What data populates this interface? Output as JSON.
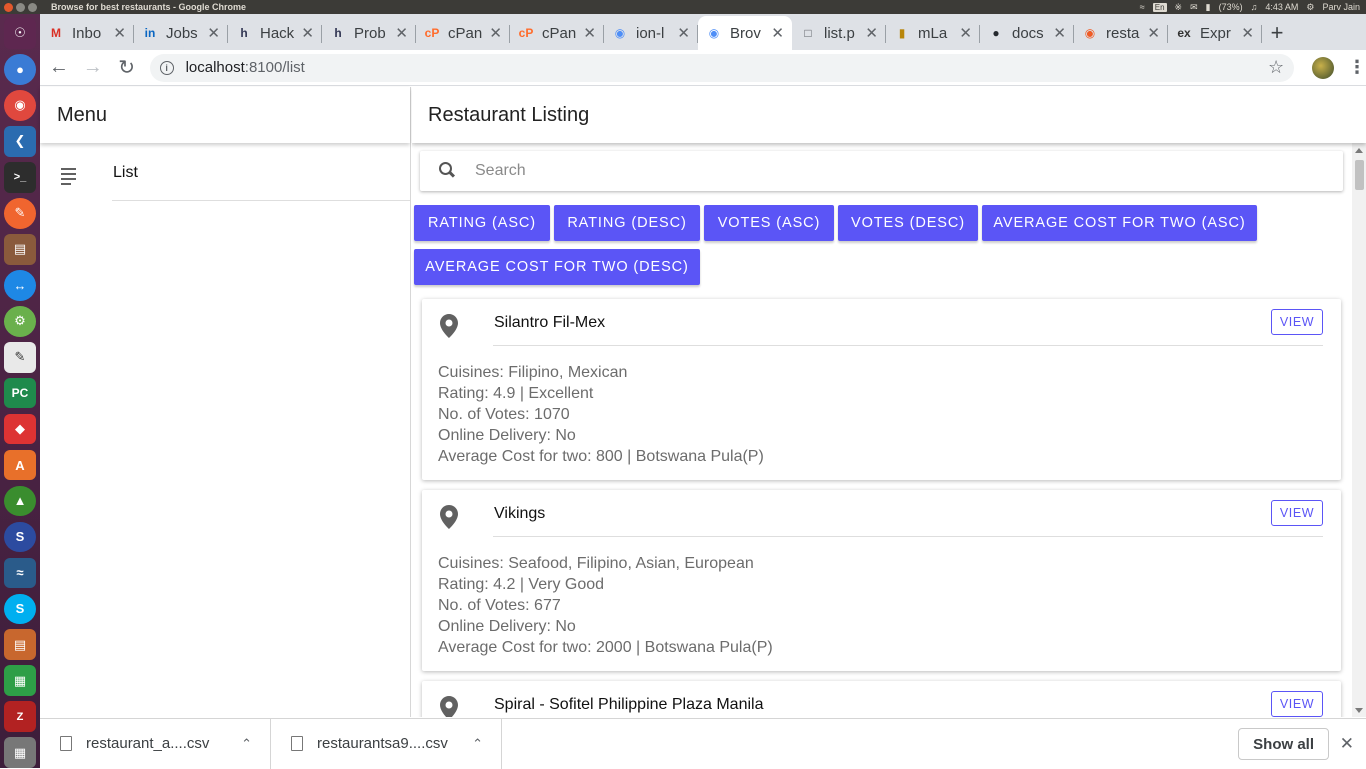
{
  "os": {
    "window_title": "Browse for best restaurants - Google Chrome",
    "tray": {
      "battery": "(73%)",
      "time": "4:43 AM",
      "user": "Parv Jain",
      "lang": "En"
    }
  },
  "browser": {
    "tabs": [
      {
        "label": "Inbo",
        "icon": "gmail-icon",
        "active": false
      },
      {
        "label": "Jobs",
        "icon": "linkedin-icon",
        "active": false
      },
      {
        "label": "Hack",
        "icon": "hackerearth-icon",
        "active": false
      },
      {
        "label": "Prob",
        "icon": "hackerearth-icon",
        "active": false
      },
      {
        "label": "cPan",
        "icon": "cpanel-icon",
        "active": false
      },
      {
        "label": "cPan",
        "icon": "cpanel-icon",
        "active": false
      },
      {
        "label": "ion-l",
        "icon": "ionic-icon",
        "active": false
      },
      {
        "label": "Brov",
        "icon": "ionic-icon",
        "active": true
      },
      {
        "label": "list.p",
        "icon": "file-icon",
        "active": false
      },
      {
        "label": "mLa",
        "icon": "mlab-icon",
        "active": false
      },
      {
        "label": "docs",
        "icon": "github-icon",
        "active": false
      },
      {
        "label": "resta",
        "icon": "postman-icon",
        "active": false
      },
      {
        "label": "Expr",
        "icon": "express-icon",
        "active": false
      }
    ],
    "url_host": "localhost",
    "url_path": ":8100/list"
  },
  "app": {
    "menu_title": "Menu",
    "menu_items": [
      {
        "label": "List"
      }
    ],
    "page_title": "Restaurant Listing",
    "search_placeholder": "Search",
    "sort_buttons": [
      "RATING (ASC)",
      "RATING (DESC)",
      "VOTES (ASC)",
      "VOTES (DESC)",
      "AVERAGE COST FOR TWO (ASC)",
      "AVERAGE COST FOR TWO (DESC)"
    ],
    "view_label": "VIEW",
    "restaurants": [
      {
        "name": "Silantro Fil-Mex",
        "cuisines": "Cuisines: Filipino, Mexican",
        "rating": "Rating: 4.9 | Excellent",
        "votes": "No. of Votes: 1070",
        "delivery": "Online Delivery: No",
        "cost": "Average Cost for two: 800 | Botswana Pula(P)"
      },
      {
        "name": "Vikings",
        "cuisines": "Cuisines: Seafood, Filipino, Asian, European",
        "rating": "Rating: 4.2 | Very Good",
        "votes": "No. of Votes: 677",
        "delivery": "Online Delivery: No",
        "cost": "Average Cost for two: 2000 | Botswana Pula(P)"
      },
      {
        "name": "Spiral - Sofitel Philippine Plaza Manila",
        "cuisines": "",
        "rating": "",
        "votes": "",
        "delivery": "",
        "cost": ""
      }
    ],
    "accent_color": "#5b55f6"
  },
  "downloads": {
    "items": [
      {
        "name": "restaurant_a....csv"
      },
      {
        "name": "restaurantsa9....csv"
      }
    ],
    "show_all_label": "Show all"
  }
}
